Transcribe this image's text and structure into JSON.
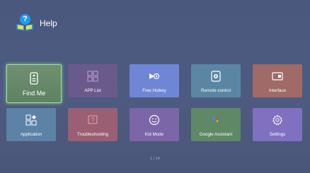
{
  "header": {
    "title": "Help",
    "icon": "help-book-icon"
  },
  "tiles": [
    {
      "label": "Find Me",
      "icon": "remote-icon",
      "color": "#6a8a6c",
      "focused": true
    },
    {
      "label": "APP List",
      "icon": "app-list-icon",
      "color": "#6a5a8c"
    },
    {
      "label": "Free Hotkey",
      "icon": "hotkey-icon",
      "color": "#6f86d6"
    },
    {
      "label": "Remote control",
      "icon": "remote-control-icon",
      "color": "#5a86a4"
    },
    {
      "label": "Interface",
      "icon": "interface-icon",
      "color": "#a06a66"
    },
    {
      "label": "Application",
      "icon": "application-icon",
      "color": "#5c82a6"
    },
    {
      "label": "Troubleshooting",
      "icon": "question-icon",
      "color": "#9a5f73"
    },
    {
      "label": "Kid Mode",
      "icon": "smiley-icon",
      "color": "#7b66a8"
    },
    {
      "label": "Google Assistant",
      "icon": "assistant-icon",
      "color": "#5f8867"
    },
    {
      "label": "Settings",
      "icon": "gear-icon",
      "color": "#7f70c0"
    }
  ],
  "pager": {
    "text": "1 / 14"
  }
}
